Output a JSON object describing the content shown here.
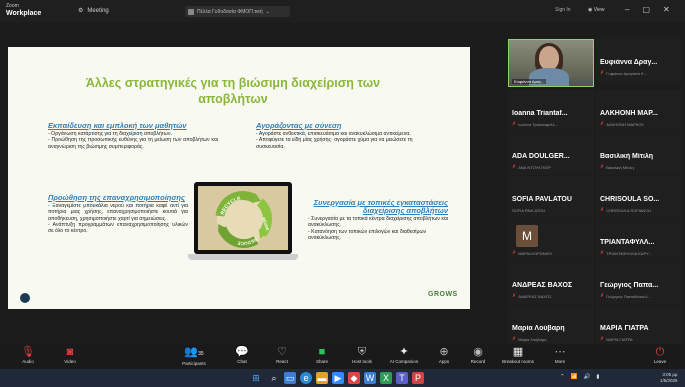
{
  "app": {
    "title_line1": "Zoom",
    "title_line2": "Workplace",
    "meeting_label": "Meeting",
    "share_label": "Πέλλα Γυδοδασία ΦΜΟΠ.τική",
    "signin": "Sign In",
    "view_label": "View",
    "window_controls": [
      "–",
      "▢",
      "✕"
    ]
  },
  "slide": {
    "title": "Άλλες στρατηγικές για τη βιώσιμη διαχείριση των αποβλήτων",
    "sections": [
      {
        "heading": "Εκπαίδευση και εμπλοκή των μαθητών",
        "lines": [
          "- Οργάνωση κατάρτισης για τη διαχείριση αποβλήτων.",
          "- Προώθηση της προσωπικής ευθύνης για τη μείωση των αποβλήτων και αναγνώριση της βιώσιμης συμπεριφοράς."
        ]
      },
      {
        "heading": "Αγοράζοντας με σύνεση",
        "lines": [
          "- Αγοράστε ανθεκτικά, επισκευάσιμα και ανακυκλώσιμα αντικείμενα.",
          "- Αποφύγετε τα είδη μίας χρήσης· αγοράστε χύμα για να μειώσετε τη συσκευασία."
        ]
      },
      {
        "heading": "Προώθηση της επαναχρησιμοποίησης",
        "lines": [
          "- Ξαναγεμίστε μπουκάλια νερού και ποτήρια καφέ αντί για ποτήρια μιας χρήσης, επαναχρησιμοποιήστε κουτιά για αποθήκευση, χρησιμοποιήστε χαρτί για σημειώσεις.",
          "- Ανάπτυξη προγραμμάτων επαναχρησιμοποίησης υλικών σε όλο το κέντρο."
        ]
      },
      {
        "heading": "Συνεργασία με τοπικές εγκαταστάσεις διαχείρισης αποβλήτων",
        "lines": [
          "- Συνεργασία με τα τοπικά κέντρα διαχείρισης αποβλήτων και ανακύκλωσης.",
          "- Κατανόηση των τοπικών επιλογών και διαθεσίμων ανακύκλωσης."
        ]
      }
    ],
    "recycle_words": [
      "RECYCLE",
      "REUSE",
      "REDUCE"
    ],
    "brand": "GROWS"
  },
  "participants": [
    {
      "name": "Ευφιάννα Δραγ...",
      "sub": "Γυφιάννα Δραγάσα Κ...",
      "video": true,
      "video_label": "Ευφιάννα Δραγ..."
    },
    {
      "name": "Ioanna Triantaf...",
      "sub": "Ιωάννα Τριανταφυλλ...",
      "video": false
    },
    {
      "name": "ΑΛΚΗΟΝΗ ΜΑΡ...",
      "sub": "ΑΛΚΗΟΝΗ ΜΑΡΚΟΥ",
      "video": false
    },
    {
      "name": "ADA DOULGER...",
      "sub": "ΑΝΑ ΝΤΟΥΛΓΚΕΡ",
      "video": false
    },
    {
      "name": "Βασιλική Μίτιλη",
      "sub": "Βασιλική Μίτιλη",
      "video": false
    },
    {
      "name": "SOFIA PAVLATOU",
      "sub": "SOFIA PAVLATOU",
      "video": false
    },
    {
      "name": "CHRISOULA SO...",
      "sub": "CHRISOULA SOFIANOU",
      "video": false
    },
    {
      "name": "M",
      "sub": "ΜΑΡΙΑ ΚΟΡΩΝΙΟΥ",
      "video": false,
      "avatar": "M"
    },
    {
      "name": "ΤΡΙΑΝΤΑΦΥΛΛ...",
      "sub": "ΤΡΙΑΝΤΑΦΥΛΛΙΑ ΚΑΡΥ...",
      "video": false
    },
    {
      "name": "ΑΝΔΡΕΑΣ ΒΑΧΟΣ",
      "sub": "ΑΝΔΡΕΑΣ ΒΑΧΟΣ",
      "video": false
    },
    {
      "name": "Γεώργιος Παπα...",
      "sub": "Γεώργιος Παπαδόπουλ...",
      "video": false
    },
    {
      "name": "Μαρία Λούβαρη",
      "sub": "Μαρία Λούβαρη",
      "video": false
    },
    {
      "name": "ΜΑΡΙΑ ΓΙΑΤΡΑ",
      "sub": "ΜΑΡΙΑ ΓΙΑΤΡΑ",
      "video": false
    }
  ],
  "toolbar": {
    "audio": "Audio",
    "video": "Video",
    "participants": "Participants",
    "participants_count": "35",
    "chat": "Chat",
    "react": "React",
    "share": "Share",
    "host_tools": "Host tools",
    "ai_companion": "AI Companion",
    "apps": "Apps",
    "record": "Record",
    "breakout": "Breakout rooms",
    "more": "More",
    "leave": "Leave"
  },
  "taskbar": {
    "time": "3:05 μμ",
    "date": "1/5/2025"
  }
}
